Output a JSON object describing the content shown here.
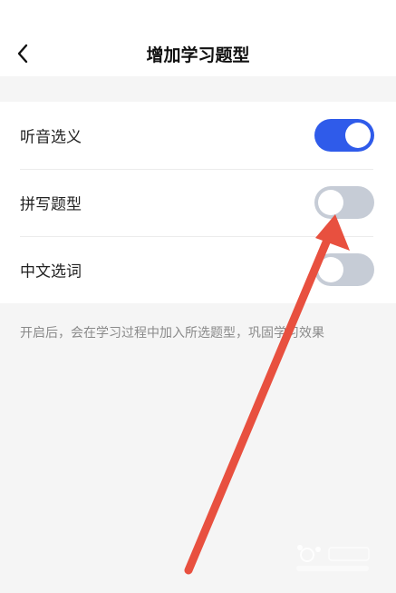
{
  "header": {
    "title": "增加学习题型",
    "back_icon": "chevron-left-icon"
  },
  "settings": {
    "items": [
      {
        "label": "听音选义",
        "enabled": true
      },
      {
        "label": "拼写题型",
        "enabled": false
      },
      {
        "label": "中文选词",
        "enabled": false
      }
    ],
    "hint": "开启后，会在学习过程中加入所选题型，巩固学习效果"
  },
  "colors": {
    "toggle_on": "#2f5bea",
    "toggle_off": "#c6ccd6",
    "annotation_arrow": "#e8503f"
  }
}
